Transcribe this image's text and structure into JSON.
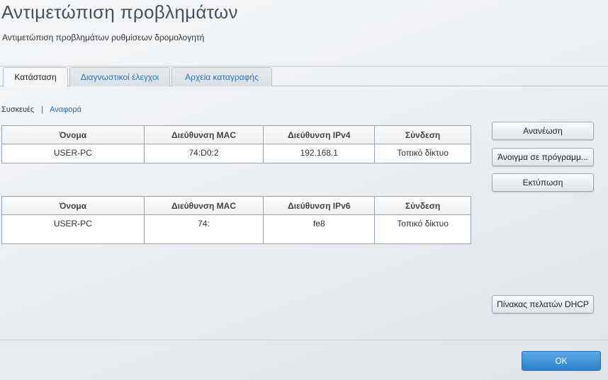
{
  "title": "Αντιμετώπιση προβλημάτων",
  "subtitle": "Αντιμετώπιση προβλημάτων ρυθμίσεων δρομολογητή",
  "tabs": [
    {
      "label": "Κατάσταση"
    },
    {
      "label": "Διαγνωστικοί έλεγχοι"
    },
    {
      "label": "Αρχεία καταγραφής"
    }
  ],
  "subnav": {
    "devices": "Συσκευές",
    "sep": "|",
    "report": "Αναφορά"
  },
  "ipv4_table": {
    "headers": [
      "Όνομα",
      "Διεύθυνση MAC",
      "Διεύθυνση IPv4",
      "Σύνδεση"
    ],
    "rows": [
      [
        "USER-PC",
        "74:D0:2",
        "192.168.1",
        "Τοπικό δίκτυο"
      ]
    ]
  },
  "ipv6_table": {
    "headers": [
      "Όνομα",
      "Διεύθυνση MAC",
      "Διεύθυνση IPv6",
      "Σύνδεση"
    ],
    "rows": [
      [
        "USER-PC",
        "74:",
        "fe8",
        "Τοπικό δίκτυο"
      ]
    ]
  },
  "buttons": {
    "refresh": "Ανανέωση",
    "open_browser": "Άνοιγμα σε πρόγραμμ...",
    "print": "Εκτύπωση",
    "dhcp": "Πίνακας πελατών DHCP",
    "ok": "OK"
  }
}
